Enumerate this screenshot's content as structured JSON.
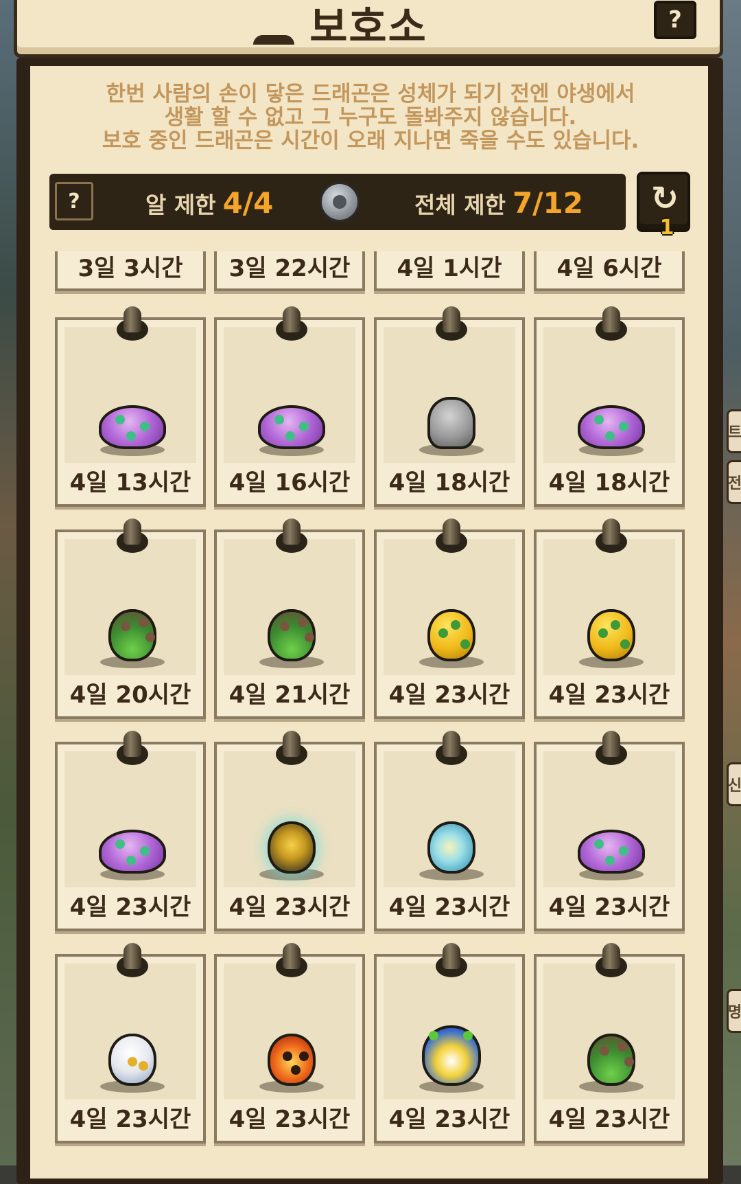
{
  "header": {
    "title": "보호소",
    "help_label": "?"
  },
  "description": {
    "lines": [
      "한번 사람의 손이 닿은 드래곤은 성체가 되기 전엔 야생에서",
      "생활 할 수 없고 그 누구도 돌봐주지 않습니다.",
      "보호 중인 드래곤은 시간이 오래 지나면 죽을 수도 있습니다."
    ]
  },
  "limits": {
    "help_label": "?",
    "egg_limit_label": "알 제한",
    "egg_limit_value": "4/4",
    "total_limit_label": "전체 제한",
    "total_limit_value": "7/12"
  },
  "refresh": {
    "icon": "refresh-icon",
    "count": "1"
  },
  "side_tabs": [
    "트",
    "전",
    "신",
    "명"
  ],
  "partial_row": [
    {
      "time": "3일 3시간"
    },
    {
      "time": "3일 22시간"
    },
    {
      "time": "4일 1시간"
    },
    {
      "time": "4일 6시간"
    }
  ],
  "slots": [
    {
      "time": "4일 13시간",
      "egg": "purple-egg"
    },
    {
      "time": "4일 16시간",
      "egg": "purple-egg"
    },
    {
      "time": "4일 18시간",
      "egg": "gray-egg"
    },
    {
      "time": "4일 18시간",
      "egg": "purple-egg"
    },
    {
      "time": "4일 20시간",
      "egg": "green-egg"
    },
    {
      "time": "4일 21시간",
      "egg": "green-egg"
    },
    {
      "time": "4일 23시간",
      "egg": "yellow-egg"
    },
    {
      "time": "4일 23시간",
      "egg": "yellow-egg"
    },
    {
      "time": "4일 23시간",
      "egg": "purple-egg"
    },
    {
      "time": "4일 23시간",
      "egg": "gold-egg"
    },
    {
      "time": "4일 23시간",
      "egg": "ice-egg"
    },
    {
      "time": "4일 23시간",
      "egg": "purple-egg"
    },
    {
      "time": "4일 23시간",
      "egg": "white-egg"
    },
    {
      "time": "4일 23시간",
      "egg": "fire-egg"
    },
    {
      "time": "4일 23시간",
      "egg": "blue-egg"
    },
    {
      "time": "4일 23시간",
      "egg": "green-egg"
    }
  ]
}
